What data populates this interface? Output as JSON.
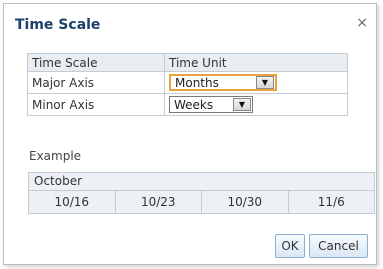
{
  "dialog": {
    "title": "Time Scale",
    "close_glyph": "×"
  },
  "table": {
    "headers": [
      "Time Scale",
      "Time Unit"
    ],
    "rows": [
      {
        "label": "Major Axis",
        "value": "Months"
      },
      {
        "label": "Minor Axis",
        "value": "Weeks"
      }
    ]
  },
  "example": {
    "label": "Example",
    "major": "October",
    "minor": [
      "10/16",
      "10/23",
      "10/30",
      "11/6"
    ]
  },
  "buttons": {
    "ok": "OK",
    "cancel": "Cancel"
  },
  "icons": {
    "close": "close-icon",
    "dropdown": "chevron-down-icon"
  },
  "colors": {
    "title": "#1d3f6a",
    "focus_border": "#e8a33a",
    "header_bg": "#e8edf2"
  }
}
